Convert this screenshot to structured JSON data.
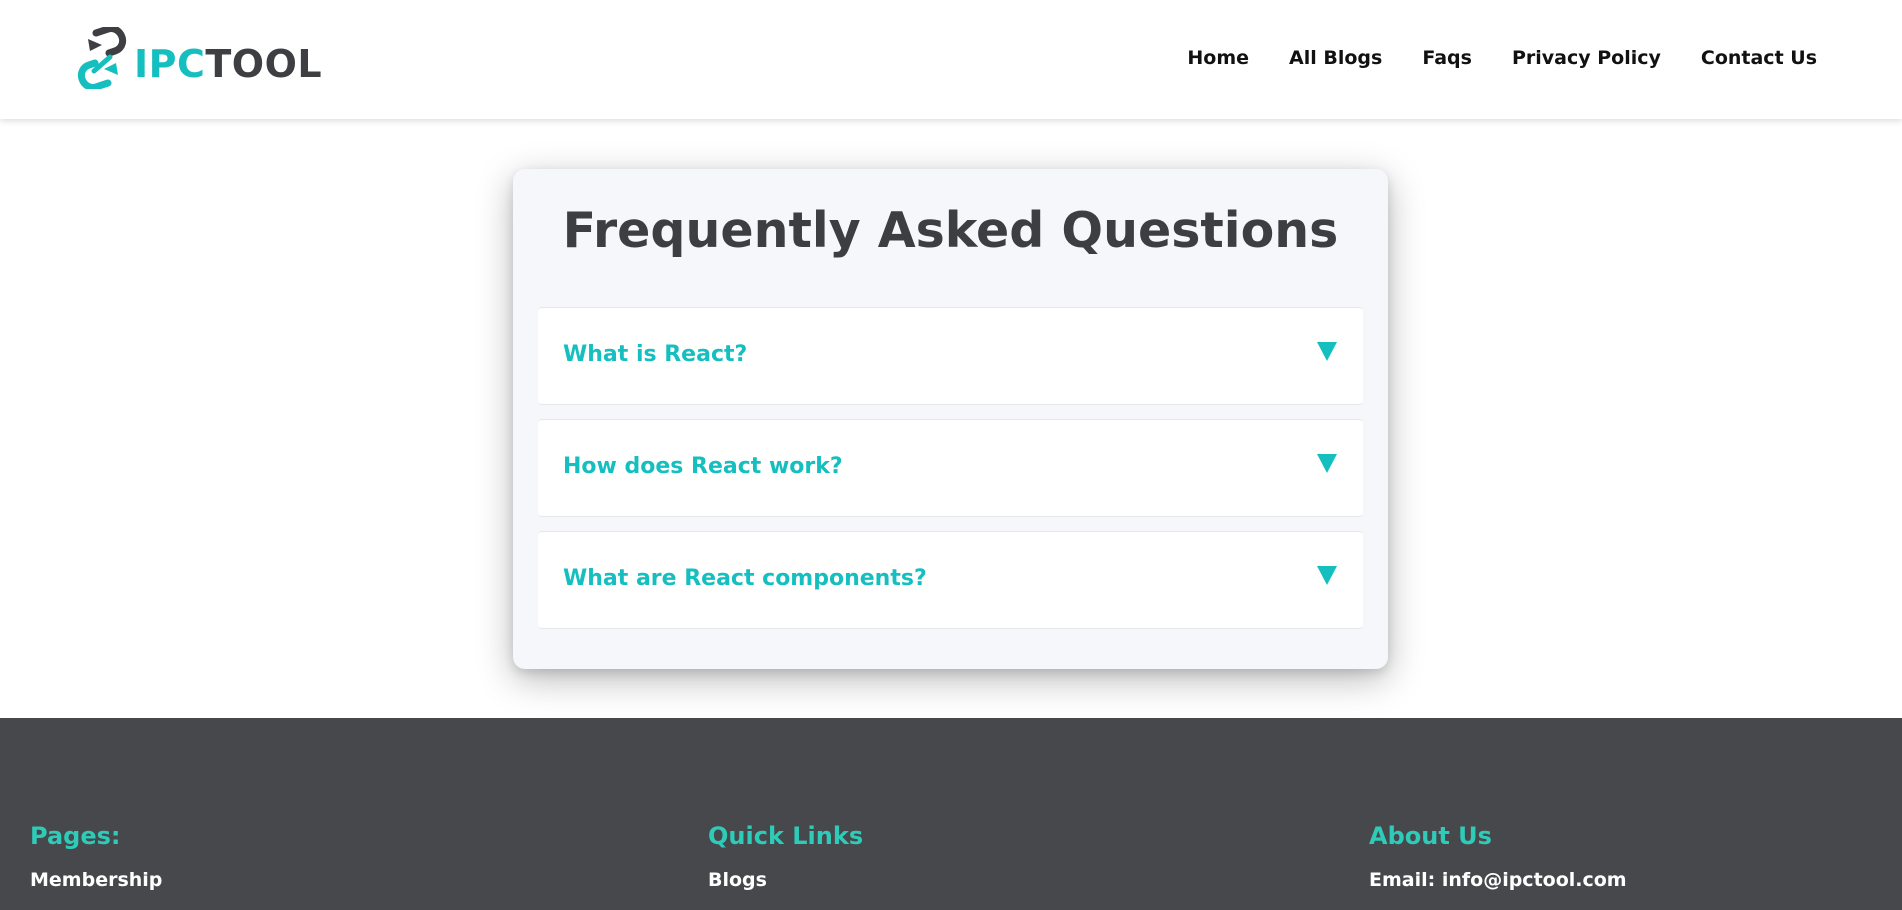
{
  "header": {
    "logo": {
      "text_a": "IPC",
      "text_b": "TOOL",
      "icon": "link-icon"
    },
    "nav": [
      {
        "label": "Home"
      },
      {
        "label": "All Blogs"
      },
      {
        "label": "Faqs"
      },
      {
        "label": "Privacy Policy"
      },
      {
        "label": "Contact Us"
      }
    ]
  },
  "faq": {
    "title": "Frequently Asked Questions",
    "items": [
      {
        "question": "What is React?",
        "icon": "triangle-down-icon"
      },
      {
        "question": "How does React work?",
        "icon": "triangle-down-icon"
      },
      {
        "question": "What are React components?",
        "icon": "triangle-down-icon"
      }
    ]
  },
  "footer": {
    "pages": {
      "heading": "Pages:",
      "links": [
        "Membership"
      ]
    },
    "quick_links": {
      "heading": "Quick Links",
      "links": [
        "Blogs"
      ]
    },
    "about": {
      "heading": "About Us",
      "email": "Email: info@ipctool.com"
    }
  },
  "colors": {
    "accent": "#16bfbf",
    "footer_accent": "#2ecbb8",
    "footer_bg": "#47484c",
    "title_text": "#3d3e41",
    "card_bg": "#f6f7fb"
  }
}
